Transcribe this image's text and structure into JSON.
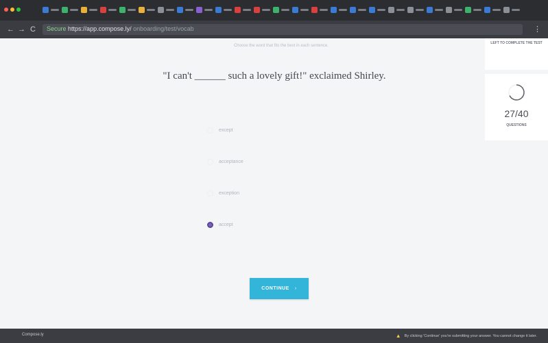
{
  "browser": {
    "url": "https://app.compose.ly/",
    "secure_label": "Secure",
    "url_path": "onboarding/test/vocab",
    "nav_back": "←",
    "nav_forward": "→",
    "nav_reload": "C",
    "menu": "⋮",
    "tab_colors": [
      "#3a7bd5",
      "#3bb36b",
      "#e8b13a",
      "#d94141",
      "#3bb36b",
      "#e8b13a",
      "#8a8f98",
      "#3a7bd5",
      "#8a5fd0",
      "#3a7bd5",
      "#d94141",
      "#d94141",
      "#3bb36b",
      "#3a7bd5",
      "#d94141",
      "#3a7bd5",
      "#3a7bd5",
      "#3a7bd5",
      "#8a8f98",
      "#8a8f98",
      "#3a7bd5",
      "#8a8f98",
      "#3bb36b",
      "#3a7bd5",
      "#8a8f98"
    ]
  },
  "question": {
    "instruction": "Choose the word that fits the best in each sentence.",
    "text": "\"I can't ______ such a lovely gift!\" exclaimed Shirley."
  },
  "options": [
    {
      "label": "except",
      "selected": false
    },
    {
      "label": "acceptance",
      "selected": false
    },
    {
      "label": "exception",
      "selected": false
    },
    {
      "label": "accept",
      "selected": true
    }
  ],
  "continue_label": "CONTINUE",
  "continue_arrow": "›",
  "sidebar": {
    "left_label": "LEFT TO COMPLETE THE TEST",
    "progress": "27/40",
    "progress_fraction": 0.675,
    "questions_label": "QUESTIONS"
  },
  "footer": {
    "brand": "Compose.ly",
    "warning": "By clicking 'Continue' you're submitting your answer. You cannot change it later."
  },
  "colors": {
    "accent": "#32b5d8",
    "selected_radio": "#7a62b9"
  }
}
